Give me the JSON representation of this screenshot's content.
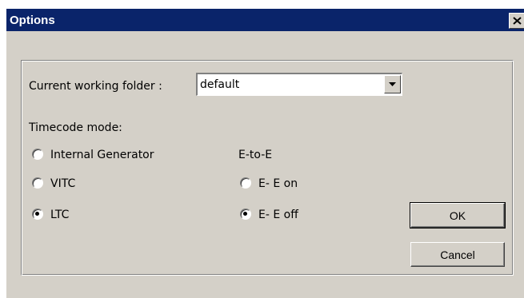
{
  "window": {
    "title": "Options",
    "close_label": "×"
  },
  "folder": {
    "label": "Current working folder :",
    "value": "default"
  },
  "timecode": {
    "label": "Timecode mode:",
    "options": [
      {
        "label": "Internal Generator",
        "selected": false
      },
      {
        "label": "VITC",
        "selected": false
      },
      {
        "label": "LTC",
        "selected": true
      }
    ]
  },
  "ete": {
    "label": "E-to-E",
    "options": [
      {
        "label": "E- E on",
        "selected": false
      },
      {
        "label": "E- E off",
        "selected": true
      }
    ]
  },
  "buttons": {
    "ok": "OK",
    "cancel": "Cancel"
  },
  "colors": {
    "titlebar": "#0a246a",
    "face": "#d4d0c8"
  },
  "icons": {
    "close": "close-icon",
    "dropdown": "chevron-down-icon"
  }
}
